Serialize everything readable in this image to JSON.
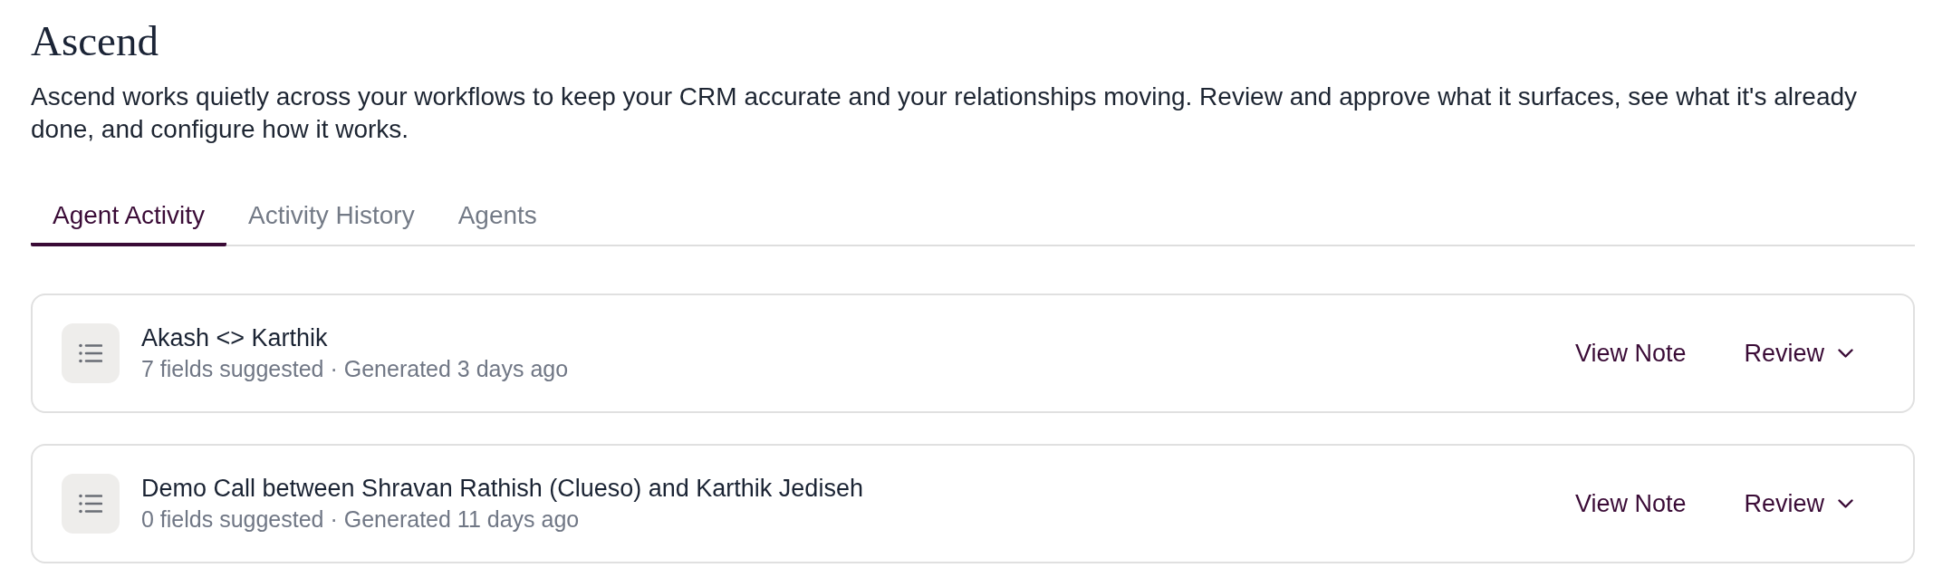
{
  "page": {
    "title": "Ascend",
    "description": "Ascend works quietly across your workflows to keep your CRM accurate and your relationships moving. Review and approve what it surfaces, see what it's already done, and configure how it works."
  },
  "tabs": [
    {
      "label": "Agent Activity",
      "selected": true
    },
    {
      "label": "Activity History",
      "selected": false
    },
    {
      "label": "Agents",
      "selected": false
    }
  ],
  "activities": [
    {
      "title": "Akash <> Karthik",
      "meta": "7 fields suggested · Generated 3 days ago",
      "actions": [
        {
          "kind": "link",
          "label": "View Note"
        },
        {
          "kind": "dropdown",
          "label": "Review"
        }
      ]
    },
    {
      "title": "Demo Call between Shravan Rathish (Clueso) and Karthik Jediseh",
      "meta": "0 fields suggested · Generated 11 days ago",
      "actions": [
        {
          "kind": "link",
          "label": "View Note"
        },
        {
          "kind": "dropdown",
          "label": "Review"
        }
      ]
    }
  ]
}
